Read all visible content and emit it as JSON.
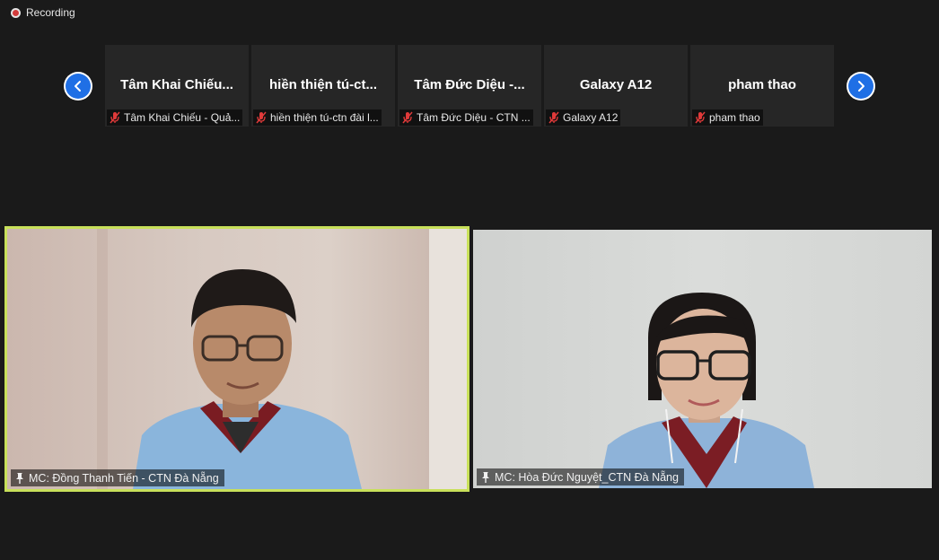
{
  "recording": {
    "label": "Recording"
  },
  "gallery": {
    "thumbnails": [
      {
        "name": "Tâm Khai Chiếu...",
        "label": "Tâm Khai Chiếu - Quả..."
      },
      {
        "name": "hiền thiện tú-ct...",
        "label": "hiền thiện tú-ctn đài l..."
      },
      {
        "name": "Tâm Đức Diệu -...",
        "label": "Tâm Đức Diệu - CTN ..."
      },
      {
        "name": "Galaxy A12",
        "label": "Galaxy A12"
      },
      {
        "name": "pham thao",
        "label": "pham thao"
      }
    ]
  },
  "videos": [
    {
      "label": "MC: Đồng Thanh Tiến - CTN Đà Nẵng",
      "active_speaker": true
    },
    {
      "label": "MC: Hòa Đức Nguyệt_CTN Đà Nẵng",
      "active_speaker": false
    }
  ],
  "icons": {
    "prev": "chevron-left-icon",
    "next": "chevron-right-icon",
    "muted": "mic-muted-icon",
    "spotlight": "pin-icon"
  },
  "colors": {
    "accent_blue": "#1f6fe5",
    "active_speaker_border": "#c8e05a",
    "muted_red": "#e03a3a",
    "background": "#1a1a1a"
  }
}
